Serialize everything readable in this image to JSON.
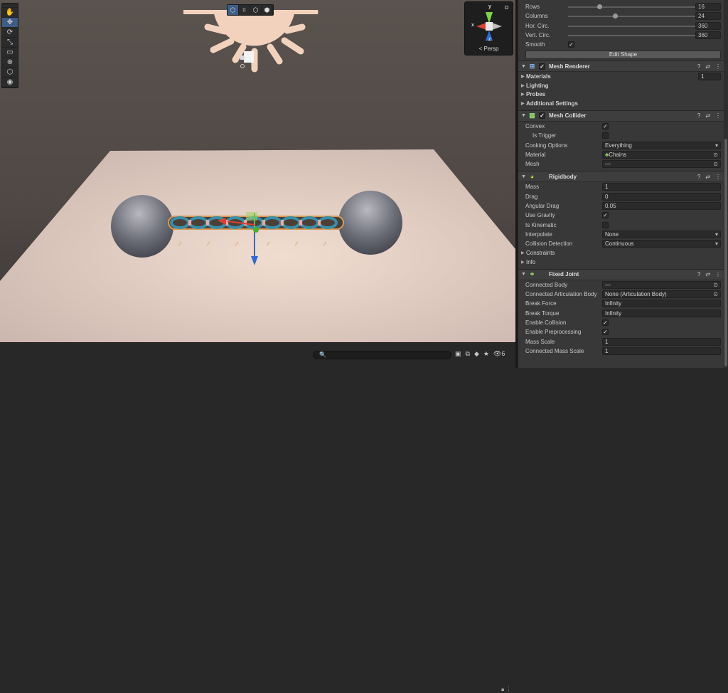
{
  "scene": {
    "tools": [
      {
        "name": "hand-tool",
        "icon": "hand-icon",
        "glyph": "✋",
        "active": false
      },
      {
        "name": "move-tool",
        "icon": "move-icon",
        "glyph": "✥",
        "active": true
      },
      {
        "name": "rotate-tool",
        "icon": "rotate-icon",
        "glyph": "⟳",
        "active": false
      },
      {
        "name": "scale-tool",
        "icon": "scale-icon",
        "glyph": "⤡",
        "active": false
      },
      {
        "name": "rect-tool",
        "icon": "rect-transform-icon",
        "glyph": "▭",
        "active": false
      },
      {
        "name": "transform-tool",
        "icon": "transform-icon",
        "glyph": "⊕",
        "active": false
      },
      {
        "name": "custom-tool",
        "icon": "custom-tool-icon",
        "glyph": "⬡",
        "active": false
      },
      {
        "name": "collider-tool",
        "icon": "collider-edit-icon",
        "glyph": "◉",
        "active": false
      }
    ],
    "overlay_buttons": [
      {
        "name": "shaded-mode-button",
        "icon": "cube-wire-icon",
        "glyph": "⬡",
        "active": true
      },
      {
        "name": "wireframe-mode-button",
        "icon": "grid-icon",
        "glyph": "⌗",
        "active": false
      },
      {
        "name": "shaded-wire-button",
        "icon": "cube-icon",
        "glyph": "⬡",
        "active": false
      },
      {
        "name": "textured-mode-button",
        "icon": "cube-filled-icon",
        "glyph": "⬢",
        "active": false
      }
    ],
    "gizmo": {
      "y_label": "y",
      "x_label": "x",
      "z_label": "z",
      "projection": "< Persp"
    },
    "search_placeholder": "🔍",
    "bottom_count": "6"
  },
  "inspector": {
    "shape": {
      "rows_label": "Rows",
      "rows_value": "16",
      "rows_fraction": 0.24,
      "columns_label": "Columns",
      "columns_value": "24",
      "columns_fraction": 0.36,
      "hor_label": "Hor. Circ.",
      "hor_value": "360",
      "hor_fraction": 1.0,
      "vert_label": "Vert. Circ.",
      "vert_value": "360",
      "vert_fraction": 1.0,
      "smooth_label": "Smooth",
      "edit_shape_label": "Edit Shape"
    },
    "mesh_renderer": {
      "title": "Mesh Renderer",
      "materials_label": "Materials",
      "materials_count": "1",
      "lighting_label": "Lighting",
      "probes_label": "Probes",
      "additional_label": "Additional Settings"
    },
    "mesh_collider": {
      "title": "Mesh Collider",
      "convex_label": "Convex",
      "trigger_label": "Is Trigger",
      "cooking_label": "Cooking Options",
      "cooking_value": "Everything",
      "material_label": "Material",
      "material_value": "Chains",
      "mesh_label": "Mesh",
      "mesh_value": "—"
    },
    "rigidbody": {
      "title": "Rigidbody",
      "mass_label": "Mass",
      "mass_value": "1",
      "drag_label": "Drag",
      "drag_value": "0",
      "angular_label": "Angular Drag",
      "angular_value": "0.05",
      "gravity_label": "Use Gravity",
      "kinematic_label": "Is Kinematic",
      "interpolate_label": "Interpolate",
      "interpolate_value": "None",
      "collision_label": "Collision Detection",
      "collision_value": "Continuous",
      "constraints_label": "Constraints",
      "info_label": "Info"
    },
    "fixed_joint": {
      "title": "Fixed Joint",
      "connected_label": "Connected Body",
      "connected_value": "—",
      "art_label": "Connected Articulation Body",
      "art_value": "None (Articulation Body)",
      "break_force_label": "Break Force",
      "break_force_value": "Infinity",
      "break_torque_label": "Break Torque",
      "break_torque_value": "Infinity",
      "enable_collision_label": "Enable Collision",
      "enable_pre_label": "Enable Preprocessing",
      "mass_scale_label": "Mass Scale",
      "mass_scale_value": "1",
      "conn_mass_label": "Connected Mass Scale",
      "conn_mass_value": "1"
    }
  }
}
